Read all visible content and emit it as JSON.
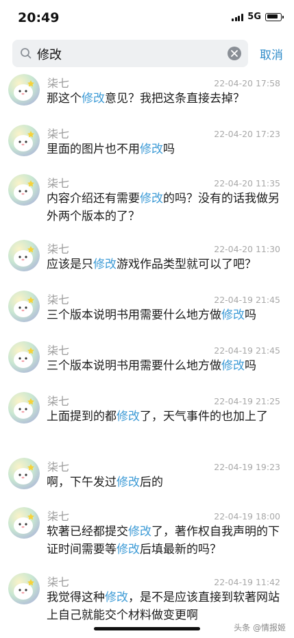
{
  "status": {
    "time": "20:49",
    "network": "5G"
  },
  "search": {
    "query": "修改",
    "cancel_label": "取消"
  },
  "messages": [
    {
      "sender": "柒七",
      "time": "22-04-20 17:58",
      "parts": [
        {
          "t": "那这个"
        },
        {
          "t": "修改",
          "h": true
        },
        {
          "t": "意见？我把这条直接去掉？"
        }
      ]
    },
    {
      "sender": "柒七",
      "time": "22-04-20 17:23",
      "parts": [
        {
          "t": "里面的图片也不用"
        },
        {
          "t": "修改",
          "h": true
        },
        {
          "t": "吗"
        }
      ]
    },
    {
      "sender": "柒七",
      "time": "22-04-20 11:35",
      "parts": [
        {
          "t": "内容介绍还有需要"
        },
        {
          "t": "修改",
          "h": true
        },
        {
          "t": "的吗？没有的话我做另外两个版本的了？"
        }
      ]
    },
    {
      "sender": "柒七",
      "time": "22-04-20 11:30",
      "parts": [
        {
          "t": "应该是只"
        },
        {
          "t": "修改",
          "h": true
        },
        {
          "t": "游戏作品类型就可以了吧？"
        }
      ]
    },
    {
      "sender": "柒七",
      "time": "22-04-19 21:45",
      "parts": [
        {
          "t": "三个版本说明书用需要什么地方做"
        },
        {
          "t": "修改",
          "h": true
        },
        {
          "t": "吗"
        }
      ]
    },
    {
      "sender": "柒七",
      "time": "22-04-19 21:45",
      "parts": [
        {
          "t": "三个版本说明书用需要什么地方做"
        },
        {
          "t": "修改",
          "h": true
        },
        {
          "t": "吗"
        }
      ]
    },
    {
      "sender": "柒七",
      "time": "22-04-19 21:25",
      "parts": [
        {
          "t": "上面提到的都"
        },
        {
          "t": "修改",
          "h": true
        },
        {
          "t": "了，天气事件的也加上了"
        }
      ]
    },
    {
      "sender": "柒七",
      "time": "22-04-19 19:23",
      "parts": [
        {
          "t": "啊，下午发过"
        },
        {
          "t": "修改",
          "h": true
        },
        {
          "t": "后的"
        }
      ]
    },
    {
      "sender": "柒七",
      "time": "22-04-19 18:00",
      "parts": [
        {
          "t": "软著已经都提交"
        },
        {
          "t": "修改",
          "h": true
        },
        {
          "t": "了，著作权自我声明的下证时间需要等"
        },
        {
          "t": "修改",
          "h": true
        },
        {
          "t": "后填最新的吗？"
        }
      ]
    },
    {
      "sender": "柒七",
      "time": "22-04-19 11:42",
      "parts": [
        {
          "t": "我觉得这种"
        },
        {
          "t": "修改",
          "h": true
        },
        {
          "t": "，是不是应该直接到软著网站上自己就能交个材料做变更啊"
        }
      ]
    }
  ],
  "watermark": "头条 @情报姬",
  "colors": {
    "highlight": "#3d9bd6",
    "cancel": "#2e8bc9",
    "search_bg": "#eef0f2"
  },
  "icons": {
    "search": "search-icon",
    "clear": "clear-icon",
    "avatar": "ghost-avatar"
  }
}
